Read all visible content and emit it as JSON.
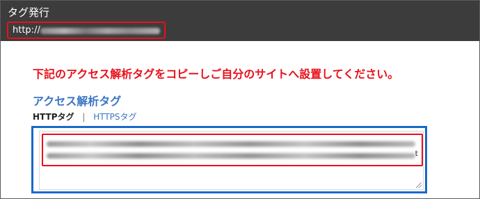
{
  "header": {
    "title": "タグ発行",
    "url_prefix": "http://"
  },
  "instruction": "下記のアクセス解析タグをコピーしご自分のサイトへ設置してください。",
  "section": {
    "title": "アクセス解析タグ"
  },
  "tabs": {
    "http_label": "HTTPタグ",
    "separator": "|",
    "https_label": "HTTPSタグ"
  },
  "code": {
    "tail_char": "t"
  },
  "colors": {
    "header_bg": "#3c3c3c",
    "highlight_red": "#e8101a",
    "focus_blue": "#1a68c8",
    "link_blue": "#3a75c4"
  }
}
